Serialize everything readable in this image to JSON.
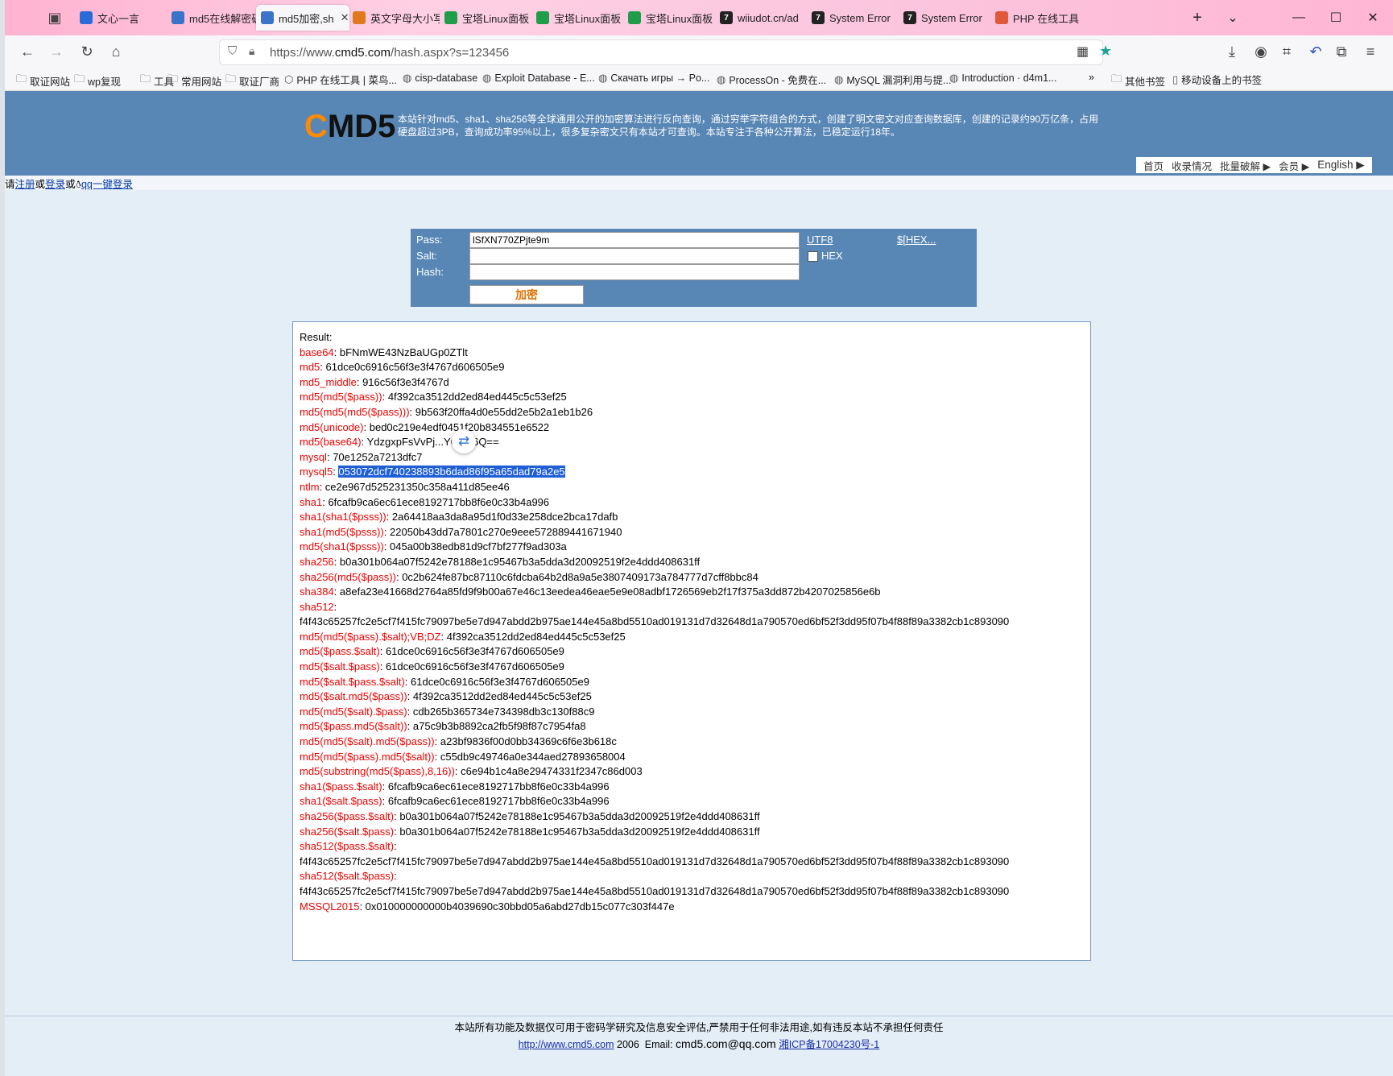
{
  "tabs": [
    {
      "label": "文心一言",
      "color": "#2b6bd8"
    },
    {
      "label": "md5在线解密破",
      "color": "#3b73c8"
    },
    {
      "label": "md5加密,sh",
      "color": "#3b73c8",
      "active": true
    },
    {
      "label": "英文字母大小写",
      "color": "#e07a1f"
    },
    {
      "label": "宝塔Linux面板",
      "color": "#1f9d4b"
    },
    {
      "label": "宝塔Linux面板",
      "color": "#1f9d4b"
    },
    {
      "label": "宝塔Linux面板",
      "color": "#1f9d4b"
    },
    {
      "label": "wiiudot.cn/ad",
      "color": "#222222"
    },
    {
      "label": "System Error",
      "color": "#222222"
    },
    {
      "label": "System Error",
      "color": "#222222"
    },
    {
      "label": "PHP 在线工具",
      "color": "#e05a3a"
    }
  ],
  "url": {
    "prefix": "https://www.",
    "domain": "cmd5.com",
    "path": "/hash.aspx?s=123456"
  },
  "bookmarks": [
    "取证网站",
    "wp复现",
    "工具",
    "常用网站",
    "取证厂商",
    "PHP 在线工具 | 菜鸟...",
    "cisp-database",
    "Exploit Database - E...",
    "Скачать игры → Po...",
    "ProcessOn - 免费在...",
    "MySQL 漏洞利用与提...",
    "Introduction · d4m1...",
    "其他书签",
    "移动设备上的书签"
  ],
  "site": {
    "logo_c": "C",
    "logo_rest": "MD5",
    "intro": "本站针对md5、sha1、sha256等全球通用公开的加密算法进行反向查询，通过穷举字符组合的方式，创建了明文密文对应查询数据库，创建的记录约90万亿条，占用硬盘超过3PB，查询成功率95%以上，很多复杂密文只有本站才可查询。本站专注于各种公开算法，已稳定运行18年。",
    "nav": [
      "首页",
      "收录情况",
      "批量破解 ▶",
      "会员 ▶",
      "English ▶"
    ],
    "login": {
      "prefix": "请",
      "register": "注册",
      "or1": "或",
      "login": "登录",
      "or2": "或",
      "qq": "qq一键登录"
    }
  },
  "form": {
    "pass_label": "Pass:",
    "pass_value": "lSfXN770ZPjte9m",
    "salt_label": "Salt:",
    "hash_label": "Hash:",
    "utf8": "UTF8",
    "hex_link": "$[HEX...",
    "hex_checkbox": "HEX",
    "button": "加密"
  },
  "result": {
    "title": "Result:",
    "rows": [
      {
        "k": "base64",
        "v": "bFNmWE43NzBaUGp0ZTlt"
      },
      {
        "k": "md5",
        "v": "61dce0c6916c56f3e3f4767d606505e9"
      },
      {
        "k": "md5_middle",
        "v": "916c56f3e3f4767d"
      },
      {
        "k": "md5(md5($pass))",
        "v": "4f392ca3512dd2ed84ed445c5c53ef25"
      },
      {
        "k": "md5(md5(md5($pass)))",
        "v": "9b563f20ffa4d0e55dd2e5b2a1eb1b26"
      },
      {
        "k": "md5(unicode)",
        "v": "bed0c219e4edf0451f20b834551e6522"
      },
      {
        "k": "md5(base64)",
        "v": "YdzgxpFsVvPj...YGUF6Q=="
      },
      {
        "k": "mysql",
        "v": "70e1252a7213dfc7"
      },
      {
        "k": "mysql5",
        "v": "053072dcf740238893b6dad86f95a65dad79a2e5",
        "hl": true
      },
      {
        "k": "ntlm",
        "v": "ce2e967d525231350c358a411d85ee46"
      },
      {
        "k": "sha1",
        "v": "6fcafb9ca6ec61ece8192717bb8f6e0c33b4a996"
      },
      {
        "k": "sha1(sha1($psss))",
        "v": "2a64418aa3da8a95d1f0d33e258dce2bca17dafb"
      },
      {
        "k": "sha1(md5($psss))",
        "v": "22050b43dd7a7801c270e9eee572889441671940"
      },
      {
        "k": "md5(sha1($psss))",
        "v": "045a00b38edb81d9cf7bf277f9ad303a"
      },
      {
        "k": "sha256",
        "v": "b0a301b064a07f5242e78188e1c95467b3a5dda3d20092519f2e4ddd408631ff"
      },
      {
        "k": "sha256(md5($pass))",
        "v": "0c2b624fe87bc87110c6fdcba64b2d8a9a5e3807409173a784777d7cff8bbc84"
      },
      {
        "k": "sha384",
        "v": "a8efa23e41668d2764a85fd9f9b00a67e46c13eedea46eae5e9e08adbf1726569eb2f17f375a3dd872b4207025856e6b"
      },
      {
        "k": "sha512",
        "v": ""
      },
      {
        "k": "",
        "v": "f4f43c65257fc2e5cf7f415fc79097be5e7d947abdd2b975ae144e45a8bd5510ad019131d7d32648d1a790570ed6bf52f3dd95f07b4f88f89a3382cb1c893090"
      },
      {
        "k": "md5(md5($pass).$salt);VB;DZ",
        "v": "4f392ca3512dd2ed84ed445c5c53ef25"
      },
      {
        "k": "md5($pass.$salt)",
        "v": "61dce0c6916c56f3e3f4767d606505e9"
      },
      {
        "k": "md5($salt.$pass)",
        "v": "61dce0c6916c56f3e3f4767d606505e9"
      },
      {
        "k": "md5($salt.$pass.$salt)",
        "v": "61dce0c6916c56f3e3f4767d606505e9"
      },
      {
        "k": "md5($salt.md5($pass))",
        "v": "4f392ca3512dd2ed84ed445c5c53ef25"
      },
      {
        "k": "md5(md5($salt).$pass)",
        "v": "cdb265b365734e734398db3c130f88c9"
      },
      {
        "k": "md5($pass.md5($salt))",
        "v": "a75c9b3b8892ca2fb5f98f87c7954fa8"
      },
      {
        "k": "md5(md5($salt).md5($pass))",
        "v": "a23bf9836f00d0bb34369c6f6e3b618c"
      },
      {
        "k": "md5(md5($pass).md5($salt))",
        "v": "c55db9c49746a0e344aed27893658004"
      },
      {
        "k": "md5(substring(md5($pass),8,16))",
        "v": "c6e94b1c4a8e29474331f2347c86d003"
      },
      {
        "k": "sha1($pass.$salt)",
        "v": "6fcafb9ca6ec61ece8192717bb8f6e0c33b4a996"
      },
      {
        "k": "sha1($salt.$pass)",
        "v": "6fcafb9ca6ec61ece8192717bb8f6e0c33b4a996"
      },
      {
        "k": "sha256($pass.$salt)",
        "v": "b0a301b064a07f5242e78188e1c95467b3a5dda3d20092519f2e4ddd408631ff"
      },
      {
        "k": "sha256($salt.$pass)",
        "v": "b0a301b064a07f5242e78188e1c95467b3a5dda3d20092519f2e4ddd408631ff"
      },
      {
        "k": "sha512($pass.$salt)",
        "v": ""
      },
      {
        "k": "",
        "v": "f4f43c65257fc2e5cf7f415fc79097be5e7d947abdd2b975ae144e45a8bd5510ad019131d7d32648d1a790570ed6bf52f3dd95f07b4f88f89a3382cb1c893090"
      },
      {
        "k": "sha512($salt.$pass)",
        "v": ""
      },
      {
        "k": "",
        "v": "f4f43c65257fc2e5cf7f415fc79097be5e7d947abdd2b975ae144e45a8bd5510ad019131d7d32648d1a790570ed6bf52f3dd95f07b4f88f89a3382cb1c893090"
      },
      {
        "k": "MSSQL2015",
        "v": "0x010000000000b4039690c30bbd05a6abd27db15c077c303f447e"
      }
    ]
  },
  "footer": {
    "notice": "本站所有功能及数据仅可用于密码学研究及信息安全评估,严禁用于任何非法用途,如有违反本站不承担任何责任",
    "site_link": "http://www.cmd5.com",
    "year": "2006",
    "email_label": "Email:",
    "email": "cmd5.com@qq.com",
    "icp": "湘ICP备17004230号-1"
  }
}
